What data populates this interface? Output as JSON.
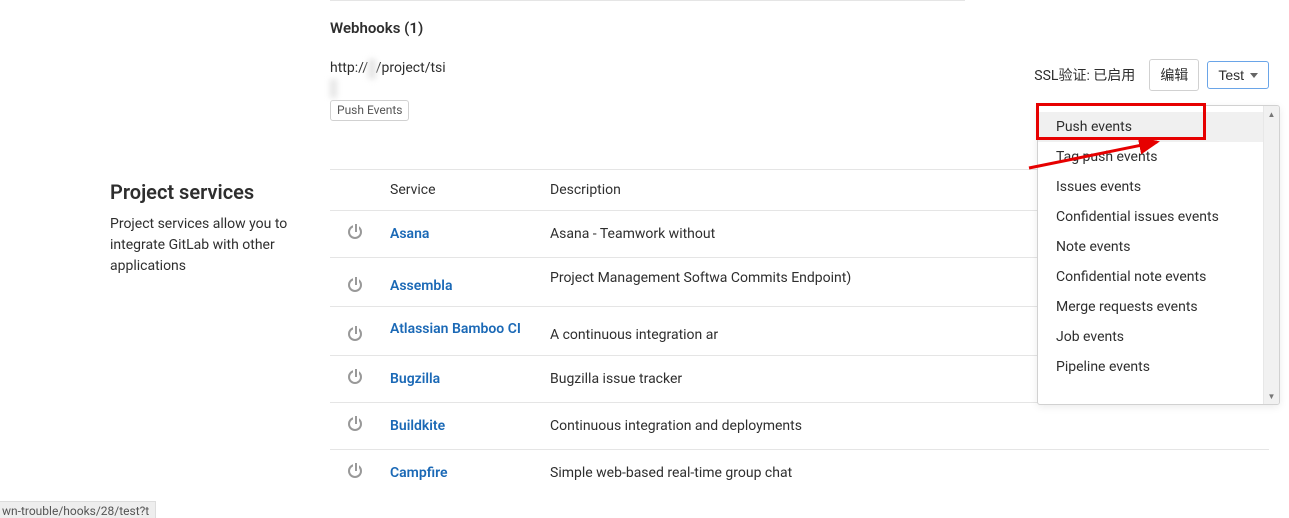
{
  "sidebar": {
    "title": "Project services",
    "description": "Project services allow you to integrate GitLab with other applications"
  },
  "webhooks": {
    "heading": "Webhooks (1)",
    "url_prefix": "http://",
    "url_blur1": "a                  ",
    "url_mid": "/project/tsi",
    "url_blur2": "        ",
    "url_line2_blur": "y      ",
    "badge": "Push Events",
    "ssl_label": "SSL验证: 已启用",
    "edit_label": "编辑",
    "test_label": "Test"
  },
  "dropdown": {
    "items": [
      "Push events",
      "Tag push events",
      "Issues events",
      "Confidential issues events",
      "Note events",
      "Confidential note events",
      "Merge requests events",
      "Job events",
      "Pipeline events"
    ]
  },
  "services": {
    "headers": {
      "service": "Service",
      "description": "Description"
    },
    "rows": [
      {
        "name": "Asana",
        "description": "Asana - Teamwork without "
      },
      {
        "name": "Assembla",
        "description": "Project Management Softwa Commits Endpoint)"
      },
      {
        "name": "Atlassian Bamboo CI",
        "description": "A continuous integration ar"
      },
      {
        "name": "Bugzilla",
        "description": "Bugzilla issue tracker"
      },
      {
        "name": "Buildkite",
        "description": "Continuous integration and deployments"
      },
      {
        "name": "Campfire",
        "description": "Simple web-based real-time group chat"
      }
    ]
  },
  "statusbar": "wn-trouble/hooks/28/test?t"
}
